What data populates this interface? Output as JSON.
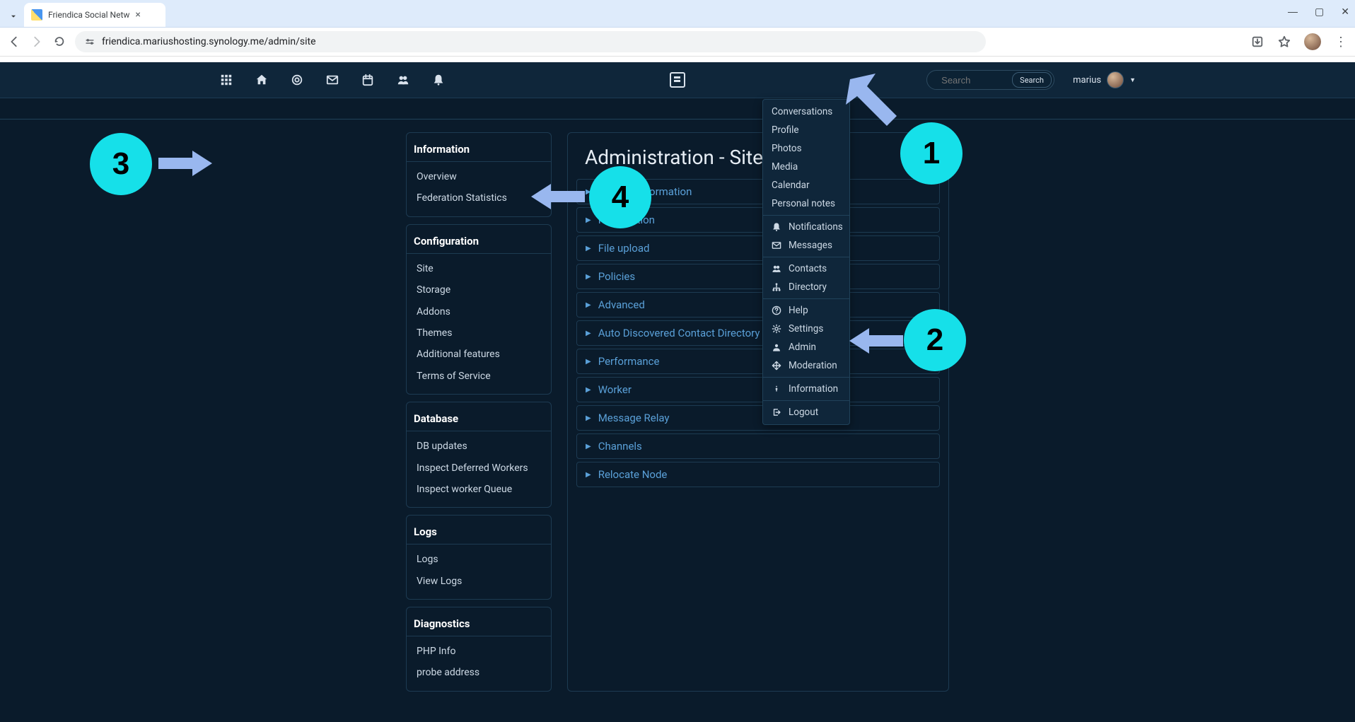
{
  "browser": {
    "tab_title": "Friendica Social Netw",
    "url": "friendica.mariushosting.synology.me/admin/site"
  },
  "topnav": {
    "search_placeholder": "Search",
    "search_button": "Search",
    "username": "marius"
  },
  "sidebar": {
    "information": {
      "title": "Information",
      "items": [
        "Overview",
        "Federation Statistics"
      ]
    },
    "configuration": {
      "title": "Configuration",
      "items": [
        "Site",
        "Storage",
        "Addons",
        "Themes",
        "Additional features",
        "Terms of Service"
      ]
    },
    "database": {
      "title": "Database",
      "items": [
        "DB updates",
        "Inspect Deferred Workers",
        "Inspect worker Queue"
      ]
    },
    "logs": {
      "title": "Logs",
      "items": [
        "Logs",
        "View Logs"
      ]
    },
    "diagnostics": {
      "title": "Diagnostics",
      "items": [
        "PHP Info",
        "probe address"
      ]
    }
  },
  "main": {
    "heading": "Administration - Site",
    "sections": [
      "General Information",
      "Registration",
      "File upload",
      "Policies",
      "Advanced",
      "Auto Discovered Contact Directory",
      "Performance",
      "Worker",
      "Message Relay",
      "Channels",
      "Relocate Node"
    ]
  },
  "usermenu": {
    "g1": [
      "Conversations",
      "Profile",
      "Photos",
      "Media",
      "Calendar",
      "Personal notes"
    ],
    "g2": [
      {
        "icon": "bell",
        "label": "Notifications"
      },
      {
        "icon": "envelope",
        "label": "Messages"
      }
    ],
    "g3": [
      {
        "icon": "users",
        "label": "Contacts"
      },
      {
        "icon": "sitemap",
        "label": "Directory"
      }
    ],
    "g4": [
      {
        "icon": "question",
        "label": "Help"
      },
      {
        "icon": "gear",
        "label": "Settings"
      },
      {
        "icon": "user",
        "label": "Admin"
      },
      {
        "icon": "arrows",
        "label": "Moderation"
      }
    ],
    "g5": [
      {
        "icon": "info",
        "label": "Information"
      }
    ],
    "g6": [
      {
        "icon": "signout",
        "label": "Logout"
      }
    ]
  },
  "annotations": {
    "b1": "1",
    "b2": "2",
    "b3": "3",
    "b4": "4"
  }
}
